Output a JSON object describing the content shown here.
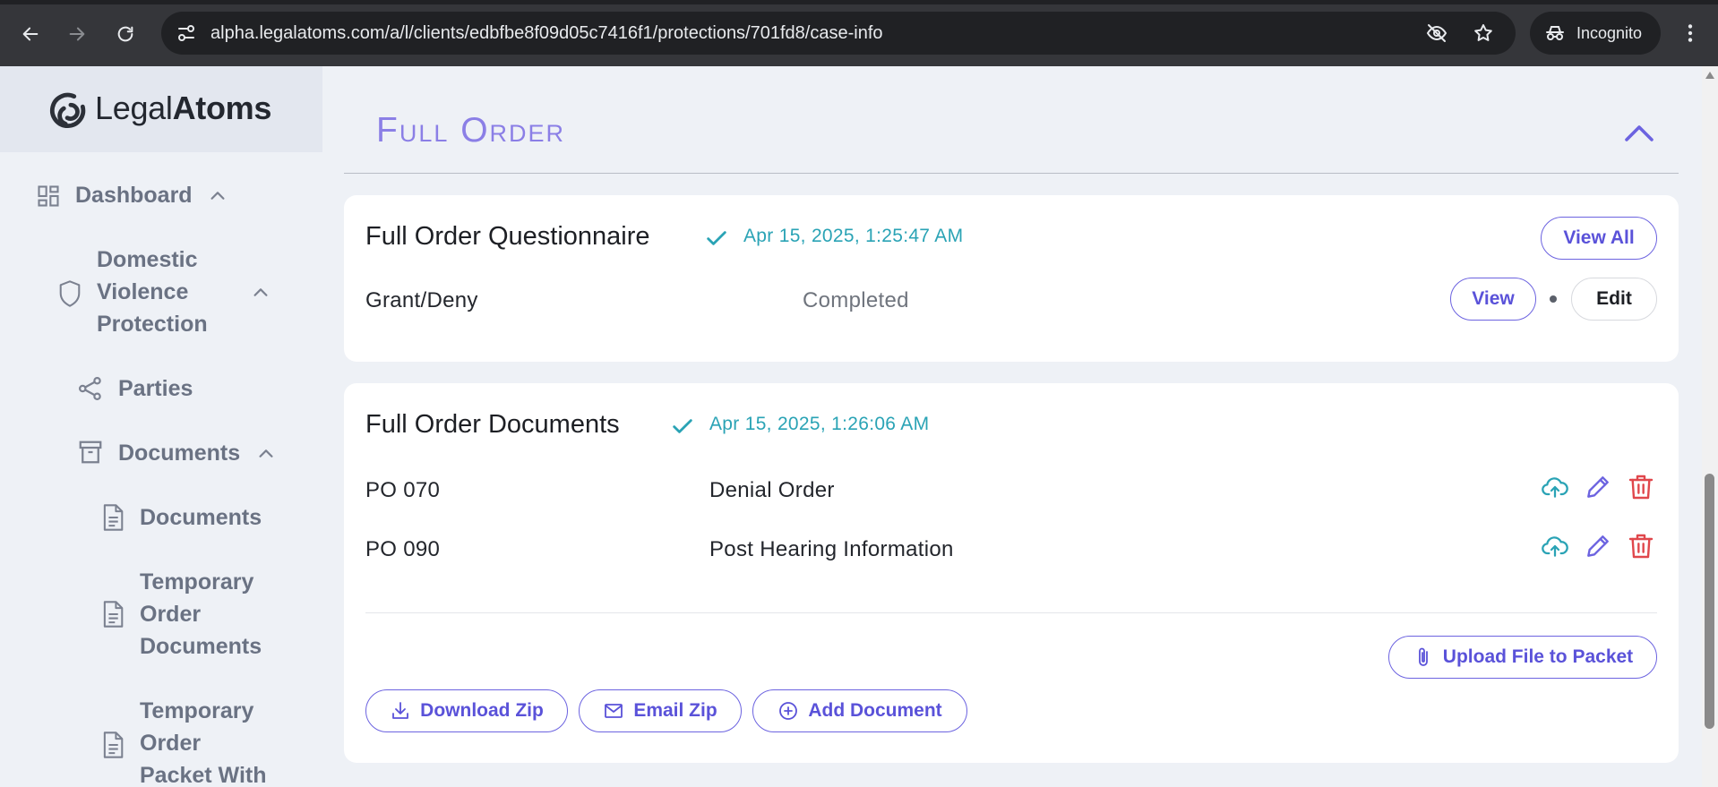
{
  "browser": {
    "url": "alpha.legalatoms.com/a/l/clients/edbfbe8f09d05c7416f1/protections/701fd8/case-info",
    "incognito_label": "Incognito"
  },
  "brand": {
    "name_light": "Legal",
    "name_bold": "Atoms",
    "accent": "#6c63e0",
    "teal": "#2aa3b5",
    "danger": "#e0474c"
  },
  "sidebar": {
    "dashboard": "Dashboard",
    "protection_line1": "Domestic",
    "protection_line2": "Violence",
    "protection_line3": "Protection",
    "parties": "Parties",
    "documents_group": "Documents",
    "documents": "Documents",
    "temp_docs_line1": "Temporary",
    "temp_docs_line2": "Order",
    "temp_docs_line3": "Documents",
    "temp_packet_line1": "Temporary",
    "temp_packet_line2": "Order",
    "temp_packet_line3": "Packet With"
  },
  "section": {
    "title": "Full Order"
  },
  "questionnaire": {
    "title": "Full Order Questionnaire",
    "timestamp": "Apr 15, 2025, 1:25:47 AM",
    "view_all_label": "View All",
    "row": {
      "name": "Grant/Deny",
      "status": "Completed",
      "view_label": "View",
      "edit_label": "Edit"
    }
  },
  "documents": {
    "title": "Full Order Documents",
    "timestamp": "Apr 15, 2025, 1:26:06 AM",
    "rows": [
      {
        "code": "PO 070",
        "name": "Denial Order"
      },
      {
        "code": "PO 090",
        "name": "Post Hearing Information"
      }
    ],
    "upload_label": "Upload File to Packet",
    "download_zip_label": "Download Zip",
    "email_zip_label": "Email Zip",
    "add_document_label": "Add Document"
  }
}
